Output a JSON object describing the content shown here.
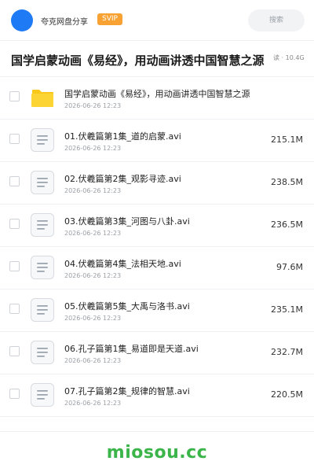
{
  "header": {
    "username": "夸克网盘分享",
    "badge": "SVIP",
    "search_placeholder": "搜索"
  },
  "share": {
    "title": "国学启蒙动画《易经》，用动画讲透中国智慧之源",
    "meta": "读 · 10.4G"
  },
  "files": [
    {
      "name": "国学启蒙动画《易经》，用动画讲透中国智慧之源",
      "date": "2026-06-26 12:23",
      "size": "",
      "type": "folder"
    },
    {
      "name": "01.伏羲篇第1集_道的启蒙.avi",
      "date": "2026-06-26 12:23",
      "size": "215.1M",
      "type": "file"
    },
    {
      "name": "02.伏羲篇第2集_观影寻迹.avi",
      "date": "2026-06-26 12:23",
      "size": "238.5M",
      "type": "file"
    },
    {
      "name": "03.伏羲篇第3集_河图与八卦.avi",
      "date": "2026-06-26 12:23",
      "size": "236.5M",
      "type": "file"
    },
    {
      "name": "04.伏羲篇第4集_法相天地.avi",
      "date": "2026-06-26 12:23",
      "size": "97.6M",
      "type": "file"
    },
    {
      "name": "05.伏羲篇第5集_大禹与洛书.avi",
      "date": "2026-06-26 12:23",
      "size": "235.1M",
      "type": "file"
    },
    {
      "name": "06.孔子篇第1集_易道即是天道.avi",
      "date": "2026-06-26 12:23",
      "size": "232.7M",
      "type": "file"
    },
    {
      "name": "07.孔子篇第2集_规律的智慧.avi",
      "date": "2026-06-26 12:23",
      "size": "220.5M",
      "type": "file"
    }
  ],
  "footer": {
    "watermark": "miosou.cc"
  },
  "colors": {
    "brand_blue": "#1f7bf5",
    "svip_orange": "#f7a233",
    "folder_yellow": "#f9c81b",
    "watermark_green": "#3bb54a"
  },
  "icons": {
    "folder": "folder-icon",
    "file": "file-text-icon"
  }
}
